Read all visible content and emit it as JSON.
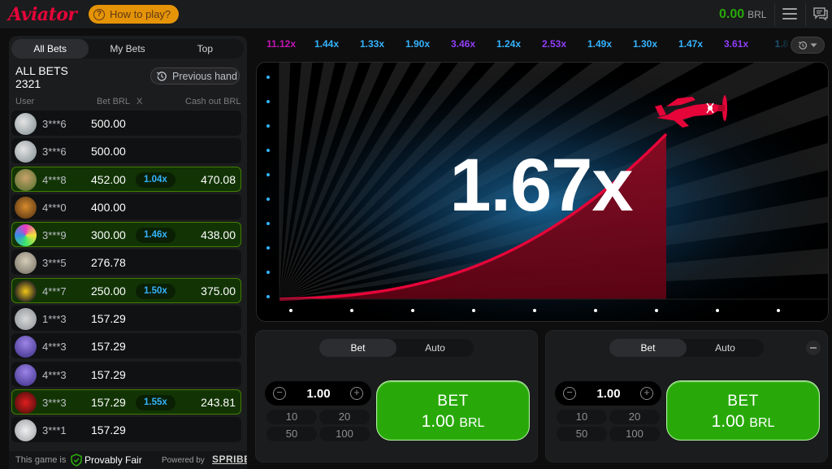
{
  "header": {
    "logo": "Aviator",
    "how_to_play": "How to play?",
    "balance": "0.00",
    "currency": "BRL"
  },
  "bets_panel": {
    "tabs": [
      "All Bets",
      "My Bets",
      "Top"
    ],
    "title": "ALL BETS",
    "count": "2321",
    "previous_hand": "Previous hand",
    "columns": {
      "user": "User",
      "bet": "Bet BRL",
      "x": "X",
      "cashout": "Cash out BRL"
    },
    "rows": [
      {
        "user": "3***6",
        "bet": "500.00",
        "mult": "",
        "cashout": "",
        "win": false,
        "avatar": "silver"
      },
      {
        "user": "3***6",
        "bet": "500.00",
        "mult": "",
        "cashout": "",
        "win": false,
        "avatar": "silver"
      },
      {
        "user": "4***8",
        "bet": "452.00",
        "mult": "1.04x",
        "cashout": "470.08",
        "win": true,
        "avatar": "brown"
      },
      {
        "user": "4***0",
        "bet": "400.00",
        "mult": "",
        "cashout": "",
        "win": false,
        "avatar": "tiger"
      },
      {
        "user": "3***9",
        "bet": "300.00",
        "mult": "1.46x",
        "cashout": "438.00",
        "win": true,
        "avatar": "colorful"
      },
      {
        "user": "3***5",
        "bet": "276.78",
        "mult": "",
        "cashout": "",
        "win": false,
        "avatar": "grey"
      },
      {
        "user": "4***7",
        "bet": "250.00",
        "mult": "1.50x",
        "cashout": "375.00",
        "win": true,
        "avatar": "yellow"
      },
      {
        "user": "1***3",
        "bet": "157.29",
        "mult": "",
        "cashout": "",
        "win": false,
        "avatar": "plane"
      },
      {
        "user": "4***3",
        "bet": "157.29",
        "mult": "",
        "cashout": "",
        "win": false,
        "avatar": "purple"
      },
      {
        "user": "4***3",
        "bet": "157.29",
        "mult": "",
        "cashout": "",
        "win": false,
        "avatar": "purple"
      },
      {
        "user": "3***3",
        "bet": "157.29",
        "mult": "1.55x",
        "cashout": "243.81",
        "win": true,
        "avatar": "red"
      },
      {
        "user": "3***1",
        "bet": "157.29",
        "mult": "",
        "cashout": "",
        "win": false,
        "avatar": "rocket"
      }
    ],
    "footer": {
      "provably_label": "This game is",
      "provably_fair": "Provably Fair",
      "powered_by": "Powered by",
      "brand": "SPRIBE"
    }
  },
  "history": [
    {
      "value": "11.12x",
      "color": "#c017b4"
    },
    {
      "value": "1.44x",
      "color": "#34b4ff"
    },
    {
      "value": "1.33x",
      "color": "#34b4ff"
    },
    {
      "value": "1.90x",
      "color": "#34b4ff"
    },
    {
      "value": "3.46x",
      "color": "#913ef8"
    },
    {
      "value": "1.24x",
      "color": "#34b4ff"
    },
    {
      "value": "2.53x",
      "color": "#913ef8"
    },
    {
      "value": "1.49x",
      "color": "#34b4ff"
    },
    {
      "value": "1.30x",
      "color": "#34b4ff"
    },
    {
      "value": "1.47x",
      "color": "#34b4ff"
    },
    {
      "value": "3.61x",
      "color": "#913ef8"
    },
    {
      "value": "1.8",
      "color": "#34b4ff"
    }
  ],
  "game": {
    "multiplier": "1.67x"
  },
  "bet_panels": [
    {
      "tabs": [
        "Bet",
        "Auto"
      ],
      "amount": "1.00",
      "quick": [
        "10",
        "20",
        "50",
        "100"
      ],
      "button_label": "BET",
      "button_amount": "1.00",
      "button_currency": "BRL",
      "show_remove": false
    },
    {
      "tabs": [
        "Bet",
        "Auto"
      ],
      "amount": "1.00",
      "quick": [
        "10",
        "20",
        "50",
        "100"
      ],
      "button_label": "BET",
      "button_amount": "1.00",
      "button_currency": "BRL",
      "show_remove": true
    }
  ],
  "colors": {
    "accent_red": "#e50539",
    "green": "#28a909",
    "blue_mult": "#34b4ff",
    "purple_mult": "#913ef8",
    "pink_mult": "#c017b4"
  }
}
